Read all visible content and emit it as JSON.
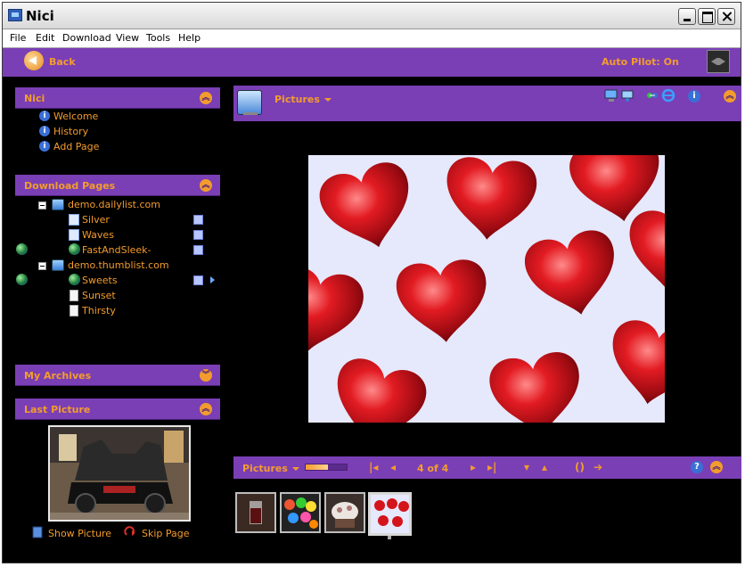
{
  "window": {
    "title": "Nici"
  },
  "menu": [
    "File",
    "Edit",
    "Download",
    "View",
    "Tools",
    "Help"
  ],
  "navbar": {
    "back_label": "Back",
    "autopilot_label": "Auto Pilot: On"
  },
  "sidebar": {
    "nici": {
      "title": "Nici",
      "items": [
        "Welcome",
        "History",
        "Add Page"
      ]
    },
    "download_pages": {
      "title": "Download Pages",
      "sites": [
        {
          "label": "demo.dailylist.com",
          "pages": [
            "Silver",
            "Waves",
            "FastAndSleek-"
          ]
        },
        {
          "label": "demo.thumblist.com",
          "pages": [
            "Sweets",
            "Sunset",
            "Thirsty"
          ]
        }
      ]
    },
    "my_archives": {
      "title": "My Archives"
    },
    "last_picture": {
      "title": "Last Picture",
      "show_label": "Show Picture",
      "skip_label": "Skip Page"
    }
  },
  "main": {
    "title": "Pictures",
    "image_description": "red foil-wrapped chocolate hearts"
  },
  "bottom_bar": {
    "label": "Pictures",
    "progress": 0.55,
    "page_indicator": "4 of 4"
  },
  "colors": {
    "accent": "#f39c2d",
    "panel": "#7a3fb5",
    "background": "#000000"
  }
}
